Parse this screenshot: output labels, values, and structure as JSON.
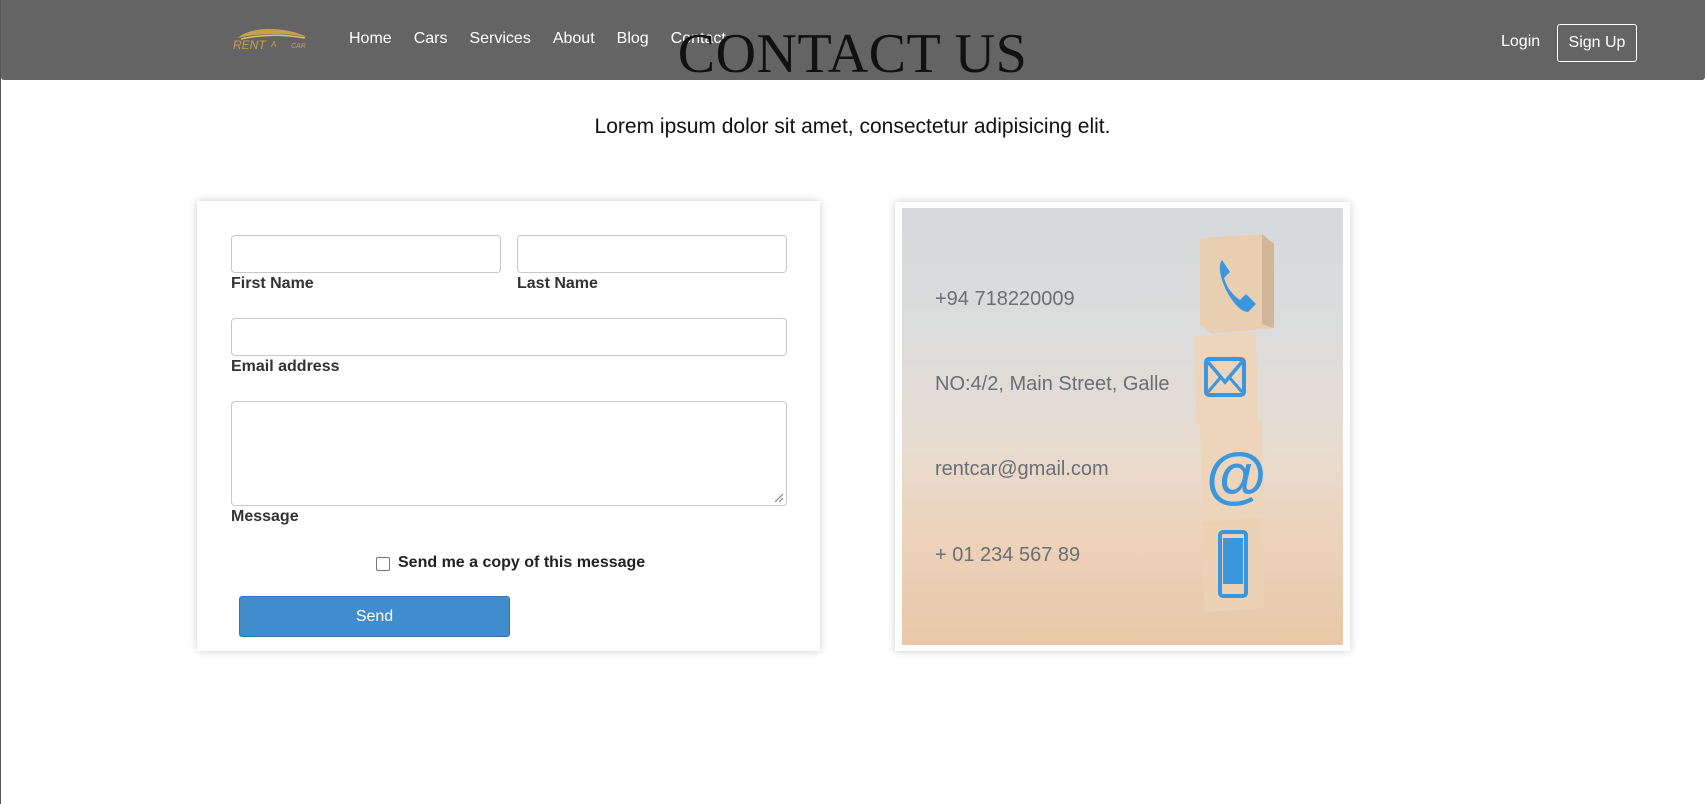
{
  "nav": {
    "logo_text": "RENT A CAR",
    "links": [
      "Home",
      "Cars",
      "Services",
      "About",
      "Blog",
      "Contact"
    ],
    "login": "Login",
    "signup": "Sign Up",
    "background": "#646464"
  },
  "header": {
    "title": "CONTACT US",
    "subtitle": "Lorem ipsum dolor sit amet, consectetur adipisicing elit."
  },
  "form": {
    "first_name_label": "First Name",
    "last_name_label": "Last Name",
    "email_label": "Email address",
    "message_label": "Message",
    "first_name_value": "",
    "last_name_value": "",
    "email_value": "",
    "message_value": "",
    "copy_checkbox_label": "Send me a copy of this message",
    "copy_checkbox_checked": false,
    "send_label": "Send",
    "send_color": "#418ccd"
  },
  "contact_info": {
    "phone": "+94 718220009",
    "address": "NO:4/2, Main Street, Galle",
    "email": "rentcar@gmail.com",
    "phone2": "+ 01 234 567 89",
    "icons": [
      "phone-icon",
      "envelope-icon",
      "at-sign-icon",
      "mobile-phone-icon"
    ],
    "icon_color": "#3a96dd"
  }
}
